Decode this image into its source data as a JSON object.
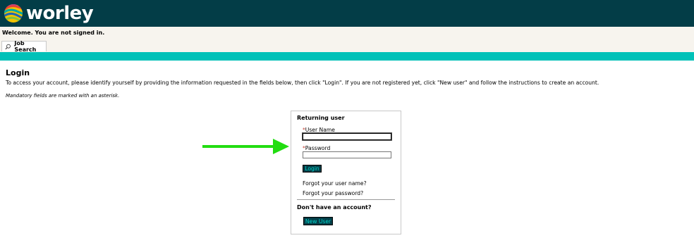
{
  "header": {
    "brand": "worley",
    "logo_icon": "worley-globe-logo-icon",
    "bg_color": "#033d47"
  },
  "status": {
    "welcome": "Welcome. You are not signed in."
  },
  "nav": {
    "tabs": [
      {
        "label": "Job Search",
        "icon": "search-icon"
      }
    ],
    "accent_color": "#00c1b8"
  },
  "main": {
    "title": "Login",
    "intro": "To access your account, please identify yourself by providing the information requested in the fields below, then click \"Login\". If you are not registered yet, click \"New user\" and follow the instructions to create an account.",
    "mandatory_note": "Mandatory fields are marked with an asterisk."
  },
  "login_box": {
    "title": "Returning user",
    "asterisk": "*",
    "username_label": "User Name",
    "username_value": "",
    "password_label": "Password",
    "password_value": "",
    "login_button": "Login",
    "forgot_username": "Forgot your user name?",
    "forgot_password": "Forgot your password?",
    "no_account": "Don't have an account?",
    "new_user_button": "New User"
  },
  "annotation": {
    "arrow_icon": "green-arrow-icon",
    "arrow_color": "#22dd11"
  }
}
